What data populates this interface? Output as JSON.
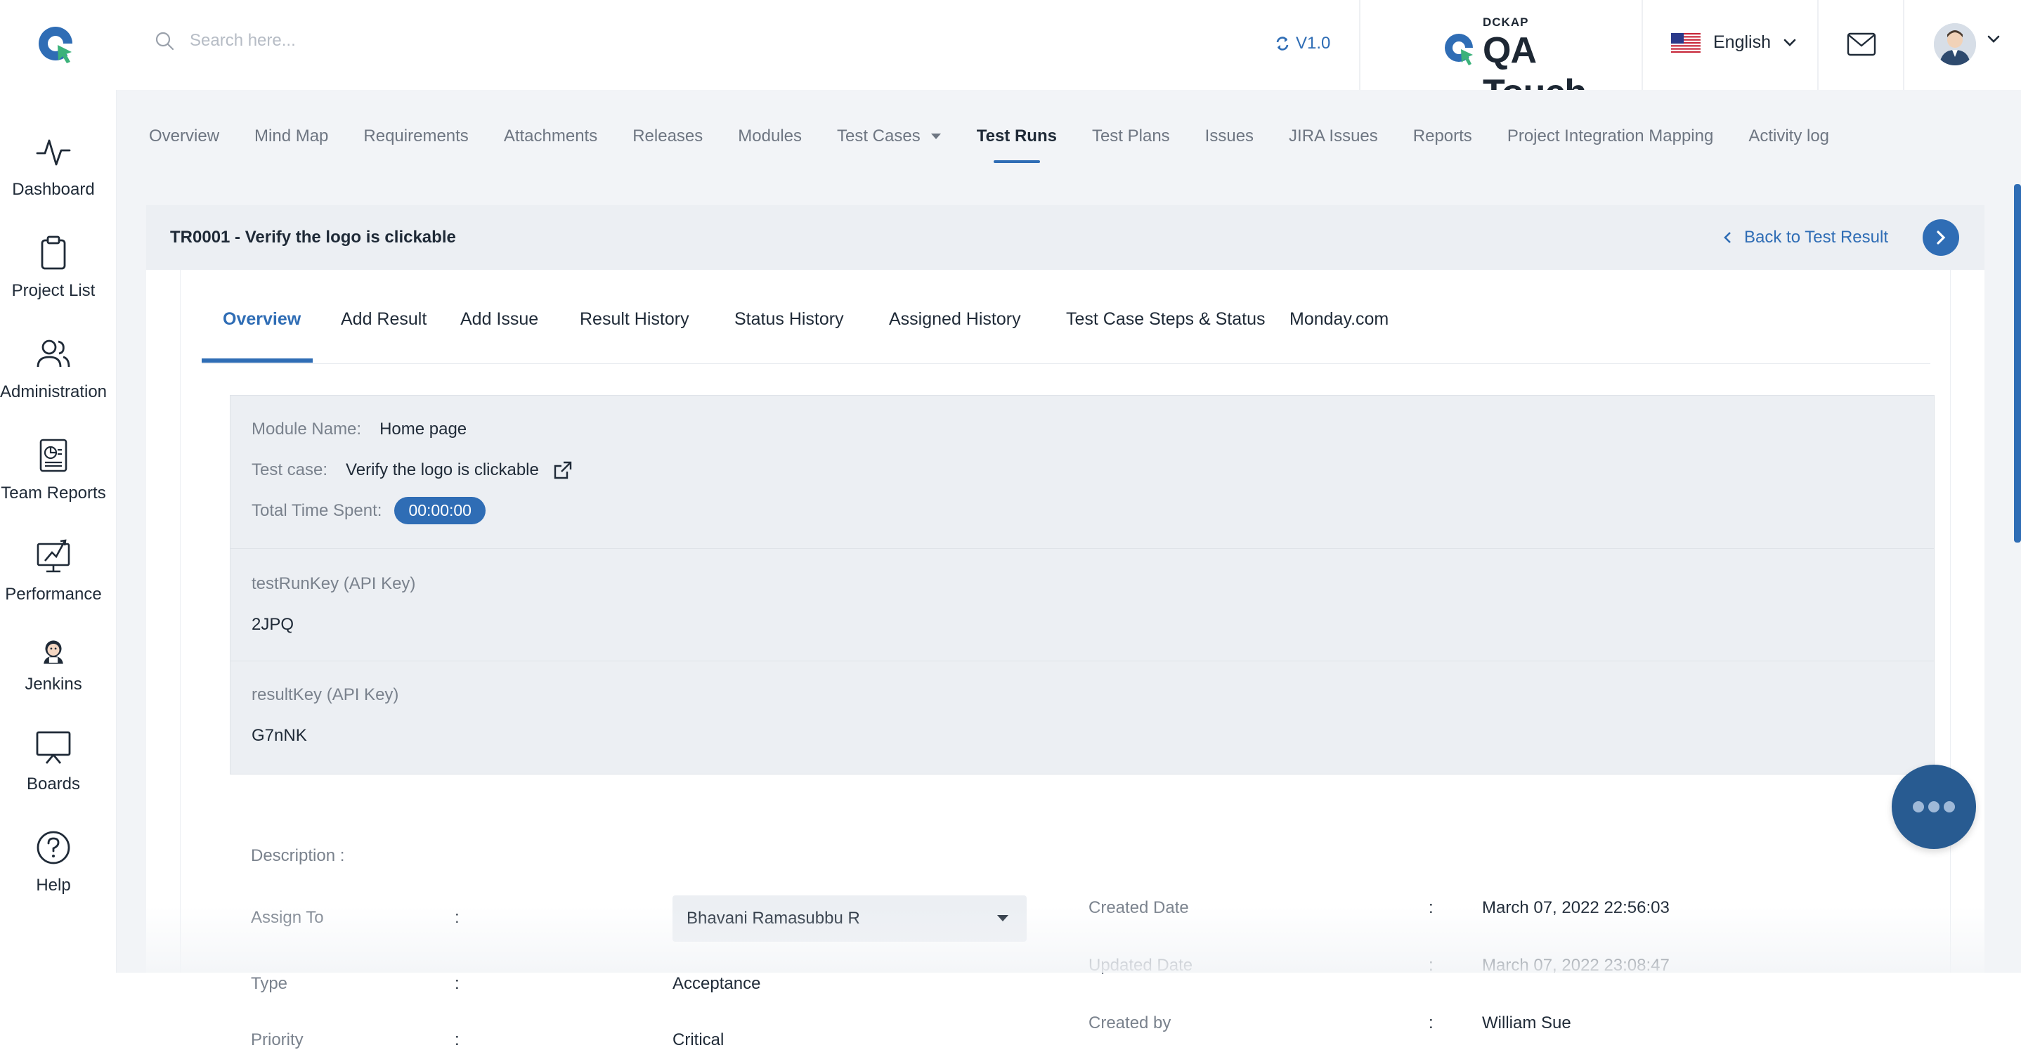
{
  "header": {
    "search_placeholder": "Search here...",
    "version": "V1.0",
    "brand_tag": "DCKAP",
    "brand_name": "QA Touch",
    "language": "English"
  },
  "sidebar": {
    "items": [
      {
        "label": "Dashboard",
        "icon": "activity-icon"
      },
      {
        "label": "Project List",
        "icon": "clipboard-icon"
      },
      {
        "label": "Administration",
        "icon": "users-icon"
      },
      {
        "label": "Team Reports",
        "icon": "report-icon"
      },
      {
        "label": "Performance",
        "icon": "performance-icon"
      },
      {
        "label": "Jenkins",
        "icon": "jenkins-icon"
      },
      {
        "label": "Boards",
        "icon": "board-icon"
      },
      {
        "label": "Help",
        "icon": "help-icon"
      }
    ]
  },
  "nav_tabs": [
    "Overview",
    "Mind Map",
    "Requirements",
    "Attachments",
    "Releases",
    "Modules",
    "Test Cases",
    "Test Runs",
    "Test Plans",
    "Issues",
    "JIRA Issues",
    "Reports",
    "Project Integration Mapping",
    "Activity log"
  ],
  "active_nav_tab": "Test Runs",
  "card": {
    "title": "TR0001 - Verify the logo is clickable",
    "back_label": "Back to Test Result"
  },
  "sub_tabs": [
    "Overview",
    "Add Result",
    "Add Issue",
    "Result History",
    "Status History",
    "Assigned History",
    "Test Case Steps & Status",
    "Monday.com"
  ],
  "info": {
    "module_label": "Module Name:",
    "module_value": "Home page",
    "testcase_label": "Test case:",
    "testcase_value": "Verify the logo is clickable",
    "time_label": "Total Time Spent:",
    "time_value": "00:00:00",
    "testrunkey_label": "testRunKey (API Key)",
    "testrunkey_value": "2JPQ",
    "resultkey_label": "resultKey (API Key)",
    "resultkey_value": "G7nNK"
  },
  "details": {
    "description_label": "Description :",
    "assign_label": "Assign To",
    "assign_value": "Bhavani Ramasubbu R",
    "type_label": "Type",
    "type_value": "Acceptance",
    "priority_label": "Priority",
    "priority_value": "Critical",
    "created_date_label": "Created Date",
    "created_date_value": "March 07, 2022 22:56:03",
    "updated_date_label": "Updated Date",
    "updated_date_value": "March 07, 2022 23:08:47",
    "created_by_label": "Created by",
    "created_by_value": "William Sue",
    "colon": ":"
  },
  "colors": {
    "accent": "#2f6db5",
    "fab": "#285b91",
    "panel": "#eceff3",
    "background": "#f2f4f7"
  }
}
